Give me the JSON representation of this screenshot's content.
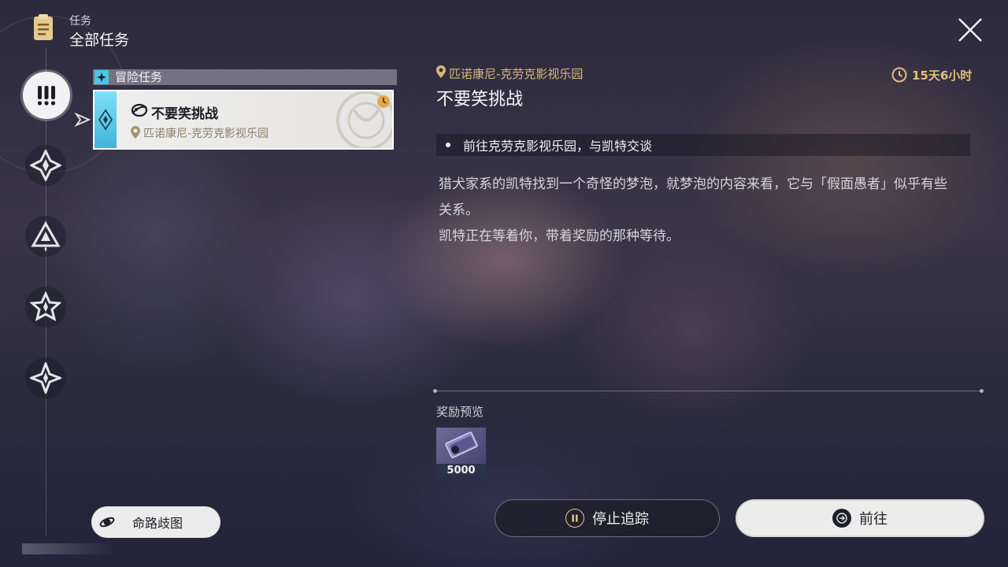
{
  "header": {
    "small_label": "任务",
    "title": "全部任务",
    "icon": "clipboard-icon"
  },
  "sidebar": {
    "items": [
      {
        "icon": "exclamation-icon",
        "active": true
      },
      {
        "icon": "diamond-star-icon",
        "active": false
      },
      {
        "icon": "triangle-star-icon",
        "active": false
      },
      {
        "icon": "star-badge-icon",
        "active": false
      },
      {
        "icon": "four-point-star-icon",
        "active": false
      }
    ]
  },
  "quest_list": {
    "category_label": "冒险任务",
    "quests": [
      {
        "title": "不要笑挑战",
        "location": "匹诺康尼-克劳克影视乐园"
      }
    ]
  },
  "detail": {
    "location": "匹诺康尼-克劳克影视乐园",
    "title": "不要笑挑战",
    "timer": "15天6小时",
    "objective": "前往克劳克影视乐园，与凯特交谈",
    "description": "猎犬家系的凯特找到一个奇怪的梦泡，就梦泡的内容来看，它与「假面愚者」似乎有些关系。",
    "description2": "凯特正在等着你，带着奖励的那种等待。",
    "reward_label": "奖励预览",
    "reward_qty": "5000"
  },
  "buttons": {
    "stop_label": "停止追踪",
    "go_label": "前往",
    "fate_label": "命路歧图"
  },
  "colors": {
    "accent_gold": "#e2c07c",
    "accent_cyan": "#4cc4e6"
  }
}
